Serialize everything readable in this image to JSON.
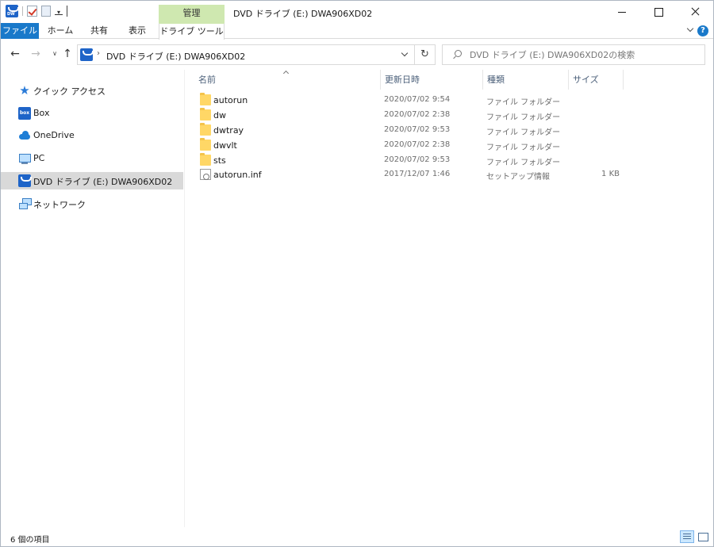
{
  "window": {
    "title": "DVD ドライブ (E:) DWA906XD02",
    "context_header": "管理"
  },
  "ribbon": {
    "tabs": [
      {
        "label": "ファイル"
      },
      {
        "label": "ホーム"
      },
      {
        "label": "共有"
      },
      {
        "label": "表示"
      },
      {
        "label": "ドライブ ツール"
      }
    ]
  },
  "address": {
    "path": "DVD ドライブ (E:) DWA906XD02"
  },
  "search": {
    "placeholder": "DVD ドライブ (E:) DWA906XD02の検索"
  },
  "navpane": {
    "items": [
      {
        "label": "クイック アクセス",
        "icon": "star-icon"
      },
      {
        "label": "Box",
        "icon": "box-icon"
      },
      {
        "label": "OneDrive",
        "icon": "cloud-icon"
      },
      {
        "label": "PC",
        "icon": "pc-icon"
      },
      {
        "label": "DVD ドライブ (E:) DWA906XD02",
        "icon": "dvd-drive-icon",
        "selected": true
      },
      {
        "label": "ネットワーク",
        "icon": "network-icon"
      }
    ]
  },
  "columns": {
    "name": "名前",
    "date": "更新日時",
    "type": "種類",
    "size": "サイズ"
  },
  "files": [
    {
      "name": "autorun",
      "date": "2020/07/02 9:54",
      "type": "ファイル フォルダー",
      "size": "",
      "icon": "folder-icon"
    },
    {
      "name": "dw",
      "date": "2020/07/02 2:38",
      "type": "ファイル フォルダー",
      "size": "",
      "icon": "folder-icon"
    },
    {
      "name": "dwtray",
      "date": "2020/07/02 9:53",
      "type": "ファイル フォルダー",
      "size": "",
      "icon": "folder-icon"
    },
    {
      "name": "dwvlt",
      "date": "2020/07/02 2:38",
      "type": "ファイル フォルダー",
      "size": "",
      "icon": "folder-icon"
    },
    {
      "name": "sts",
      "date": "2020/07/02 9:53",
      "type": "ファイル フォルダー",
      "size": "",
      "icon": "folder-icon"
    },
    {
      "name": "autorun.inf",
      "date": "2017/12/07 1:46",
      "type": "セットアップ情報",
      "size": "1 KB",
      "icon": "setup-info-icon"
    }
  ],
  "status": {
    "item_count": "6 個の項目"
  },
  "colors": {
    "file_tab": "#1979ca",
    "context_tab": "#cfe8b0",
    "folder": "#ffd766",
    "selection": "#d9d9d9"
  }
}
